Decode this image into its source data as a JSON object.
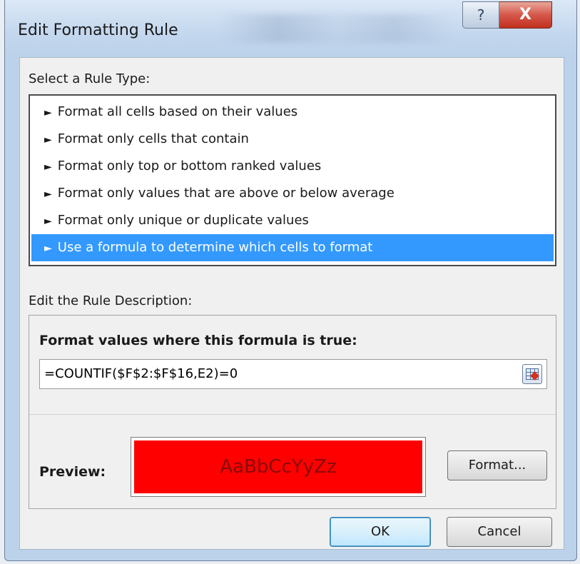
{
  "window": {
    "title": "Edit Formatting Rule",
    "help_glyph": "?",
    "close_glyph": "X"
  },
  "rule_type": {
    "label": "Select a Rule Type:",
    "items": [
      {
        "label": "Format all cells based on their values"
      },
      {
        "label": "Format only cells that contain"
      },
      {
        "label": "Format only top or bottom ranked values"
      },
      {
        "label": "Format only values that are above or below average"
      },
      {
        "label": "Format only unique or duplicate values"
      },
      {
        "label": "Use a formula to determine which cells to format"
      }
    ],
    "selected_index": 5,
    "bullet_glyph": "►"
  },
  "description": {
    "label": "Edit the Rule Description:",
    "formula_heading": "Format values where this formula is true:",
    "formula_value": "=COUNTIF($F$2:$F$16,E2)=0",
    "preview_label": "Preview:",
    "preview_text": "AaBbCcYyZz",
    "preview_fill": "#ff0000",
    "format_button": "Format..."
  },
  "buttons": {
    "ok": "OK",
    "cancel": "Cancel"
  },
  "colors": {
    "selection": "#3399ff",
    "close_button": "#c1301f"
  }
}
